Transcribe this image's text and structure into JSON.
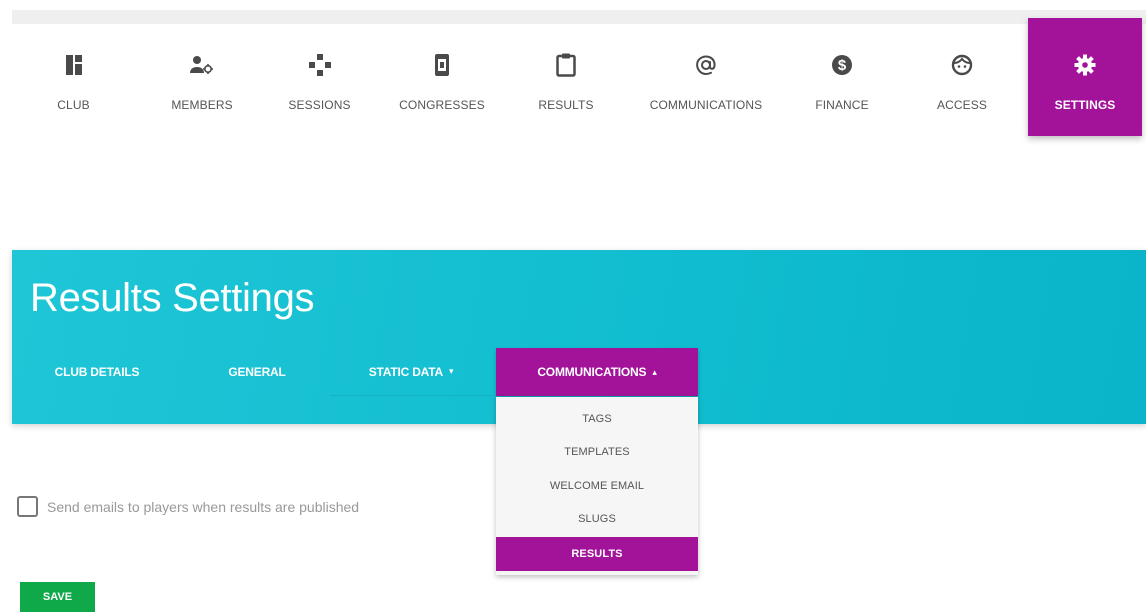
{
  "nav": {
    "items": [
      {
        "label": "CLUB",
        "icon": "club-icon"
      },
      {
        "label": "MEMBERS",
        "icon": "members-icon"
      },
      {
        "label": "SESSIONS",
        "icon": "sessions-icon"
      },
      {
        "label": "CONGRESSES",
        "icon": "congresses-icon"
      },
      {
        "label": "RESULTS",
        "icon": "results-icon"
      },
      {
        "label": "COMMUNICATIONS",
        "icon": "at-icon"
      },
      {
        "label": "FINANCE",
        "icon": "dollar-icon"
      },
      {
        "label": "ACCESS",
        "icon": "face-icon"
      },
      {
        "label": "SETTINGS",
        "icon": "gear-icon",
        "active": true
      }
    ]
  },
  "page": {
    "title": "Results Settings",
    "tabs": [
      {
        "label": "CLUB DETAILS"
      },
      {
        "label": "GENERAL"
      },
      {
        "label": "STATIC DATA",
        "caret": "▾"
      },
      {
        "label": "COMMUNICATIONS",
        "caret": "▴",
        "active": true
      }
    ]
  },
  "dropdown": {
    "items": [
      {
        "label": "TAGS"
      },
      {
        "label": "TEMPLATES"
      },
      {
        "label": "WELCOME EMAIL"
      },
      {
        "label": "SLUGS"
      },
      {
        "label": "RESULTS",
        "active": true
      }
    ]
  },
  "form": {
    "send_emails_label": "Send emails to players when results are published",
    "send_emails_checked": false,
    "save_label": "SAVE"
  },
  "colors": {
    "accent": "#a2139a",
    "hero": "#11bdd0",
    "save": "#10a94a",
    "icon": "#4a4a4a"
  }
}
